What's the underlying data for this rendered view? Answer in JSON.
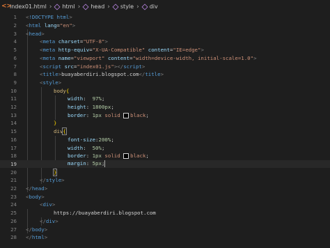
{
  "breadcrumb": {
    "file": "index01.html",
    "items": [
      "html",
      "head",
      "style",
      "div"
    ]
  },
  "icons": {
    "file": "html-file-icon",
    "element": "cube-icon"
  },
  "colors": {
    "background": "#1e1e1e",
    "tag": "#569cd6",
    "attribute": "#9cdcfe",
    "string": "#ce9178",
    "selector": "#d7ba7d",
    "number": "#b5cea8",
    "line_number": "#858585"
  },
  "editor": {
    "active_line": 19,
    "lines": [
      {
        "n": "1"
      },
      {
        "n": "2"
      },
      {
        "n": "3"
      },
      {
        "n": "4"
      },
      {
        "n": "5"
      },
      {
        "n": "6"
      },
      {
        "n": "7"
      },
      {
        "n": "8"
      },
      {
        "n": "9"
      },
      {
        "n": "10"
      },
      {
        "n": "11"
      },
      {
        "n": "12"
      },
      {
        "n": "13"
      },
      {
        "n": "14"
      },
      {
        "n": "15"
      },
      {
        "n": "16"
      },
      {
        "n": "17"
      },
      {
        "n": "18"
      },
      {
        "n": "19"
      },
      {
        "n": "20"
      },
      {
        "n": "21"
      },
      {
        "n": "22"
      },
      {
        "n": "23"
      },
      {
        "n": "24"
      },
      {
        "n": "25"
      },
      {
        "n": "26"
      },
      {
        "n": "27"
      },
      {
        "n": "28"
      }
    ],
    "code": {
      "l1_doctype": "!DOCTYPE html",
      "l2_tag": "html",
      "l2_attr": "lang",
      "l2_val": "\"en\"",
      "l3_tag": "head",
      "l4_tag": "meta",
      "l4_attr": "charset",
      "l4_val": "\"UTF-8\"",
      "l5_tag": "meta",
      "l5_attr1": "http-equiv",
      "l5_val1": "\"X-UA-Compatible\"",
      "l5_attr2": "content",
      "l5_val2": "\"IE=edge\"",
      "l6_tag": "meta",
      "l6_attr1": "name",
      "l6_val1": "\"viewport\"",
      "l6_attr2": "content",
      "l6_val2": "\"width=device-width, initial-scale=1.0\"",
      "l7_tag": "script",
      "l7_attr": "src",
      "l7_val": "\"index01.js\"",
      "l7_close": "script",
      "l8_tag": "title",
      "l8_text": "buayaberdiri.blogspot.com",
      "l8_close": "title",
      "l9_tag": "style",
      "l10_sel": "body",
      "l11_prop": "width",
      "l11_val": "97%",
      "l12_prop": "height",
      "l12_val": "1800px",
      "l13_prop": "border",
      "l13_num": "1px",
      "l13_kw": "solid",
      "l13_color": "black",
      "l15_sel": "div",
      "l16_prop": "font-size",
      "l16_val": "200%",
      "l17_prop": "width",
      "l17_val": "50%",
      "l18_prop": "border",
      "l18_num": "1px",
      "l18_kw": "solid",
      "l18_color": "black",
      "l19_prop": "margin",
      "l19_val": "5px",
      "l21_tag": "style",
      "l22_tag": "head",
      "l23_tag": "body",
      "l24_tag": "div",
      "l25_text": "https://buayaberdiri.blogspot.com",
      "l26_tag": "div",
      "l27_tag": "body",
      "l28_tag": "html"
    }
  }
}
